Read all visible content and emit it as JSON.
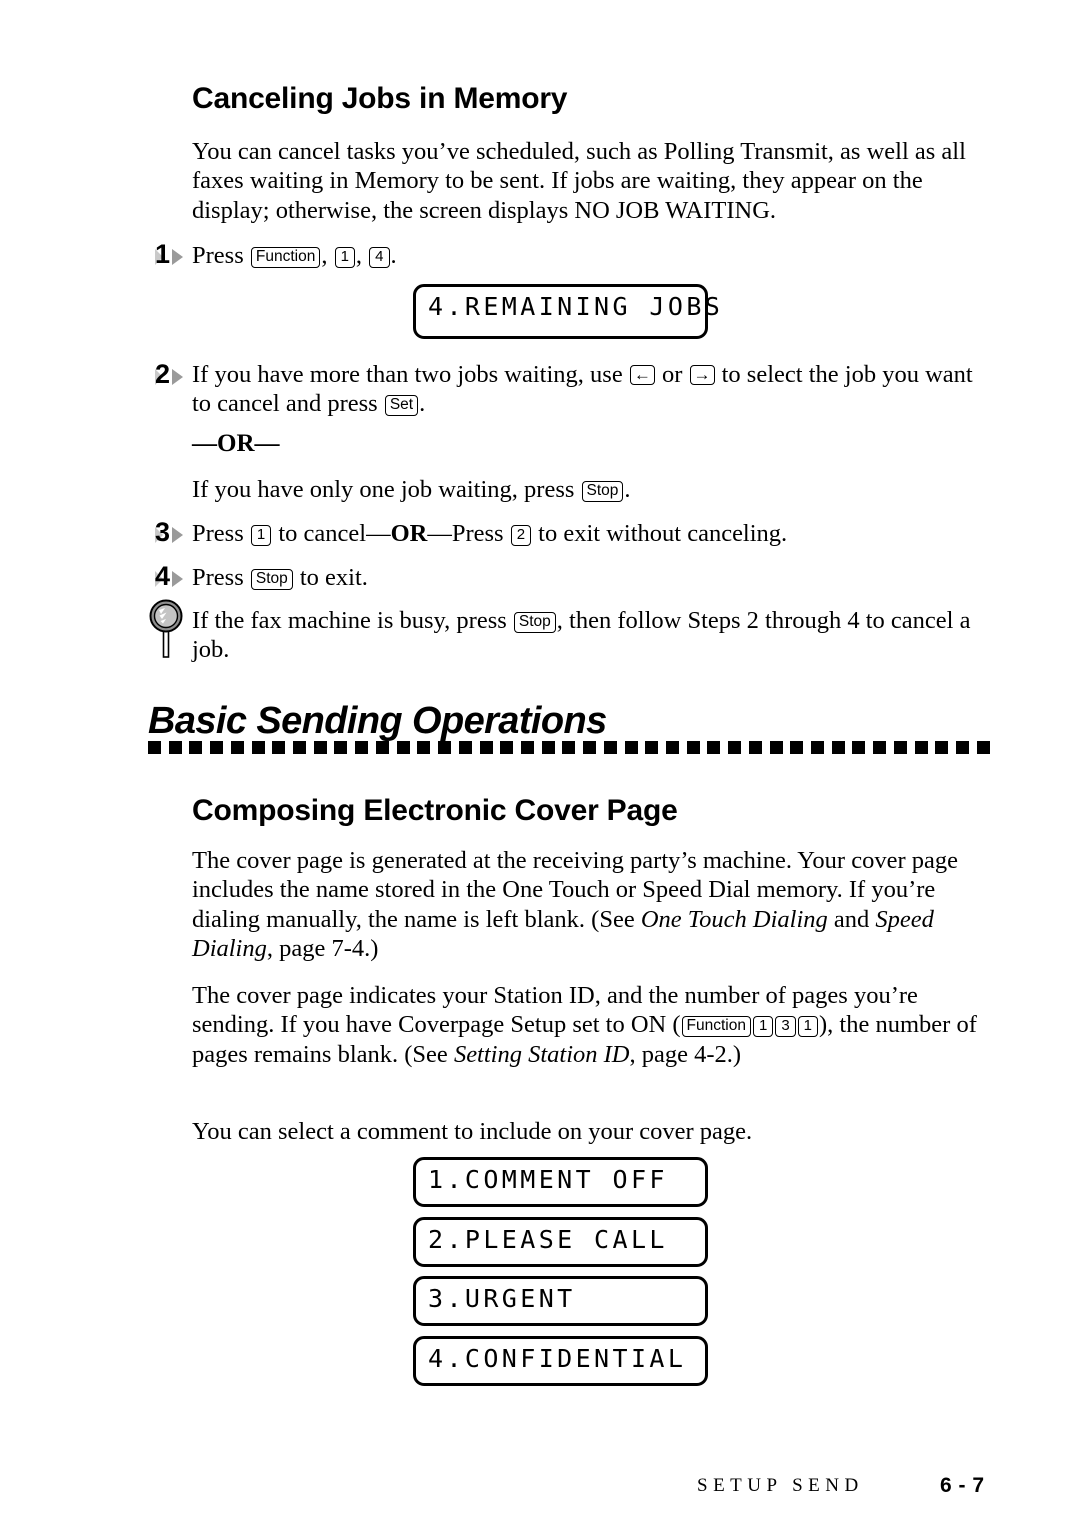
{
  "heading_1": "Canceling Jobs in Memory",
  "intro_paragraph": "You can cancel tasks you’ve scheduled, such as Polling Transmit, as well as all faxes waiting in Memory to be sent. If jobs are waiting, they appear on the display; otherwise, the screen displays NO JOB WAITING.",
  "steps": {
    "one": {
      "number": "1",
      "text_before": "Press ",
      "keys": [
        "Function",
        "1",
        "4"
      ],
      "text_after": "."
    },
    "two": {
      "number": "2",
      "part_a": "If you have more than two jobs waiting, use ",
      "key_left": "←",
      "mid": " or ",
      "key_right": "→",
      "part_b": " to select the job you want to cancel and press ",
      "key_set": "Set",
      "part_c": ".",
      "or_label": "—OR—",
      "alt_text_before": "If you have only one job waiting, press ",
      "alt_key": "Stop",
      "alt_text_after": "."
    },
    "three": {
      "number": "3",
      "part_a": "Press ",
      "key_1": "1",
      "part_b": " to cancel—",
      "or_bold": "OR",
      "part_c": "—Press ",
      "key_2": "2",
      "part_d": " to exit without canceling."
    },
    "four": {
      "number": "4",
      "part_a": "Press ",
      "key_stop": "Stop",
      "part_b": " to exit."
    }
  },
  "note": {
    "icon": "magnifier-icon",
    "part_a": "If the fax machine is busy, press ",
    "key_stop": "Stop",
    "part_b": ", then follow Steps 2 through 4 to cancel a job."
  },
  "section_title": "Basic Sending Operations",
  "heading_2": "Composing Electronic Cover Page",
  "cover_paragraph_1": {
    "part_a": "The cover page is generated at the receiving party’s machine. Your cover page includes the name stored in the One Touch or Speed Dial memory. If you’re dialing manually, the name is left blank. (See ",
    "italic_1": "One Touch Dialing",
    "part_b": " and ",
    "italic_2": "Speed Dialing",
    "part_c": ", page 7-4.)"
  },
  "cover_paragraph_2": {
    "part_a": "The cover page indicates your Station ID, and the number of pages you’re sending. If you have Coverpage Setup set to ON (",
    "keys": [
      "Function",
      "1",
      "3",
      "1"
    ],
    "part_b": "), the number of pages remains blank. (See ",
    "italic_1": "Setting Station ID",
    "part_c": ", page 4-2.)"
  },
  "cover_paragraph_3": "You can select a comment to include on your cover page.",
  "lcd_displays": {
    "remaining_jobs": "4.REMAINING JOBS",
    "comment_options": [
      "1.COMMENT OFF",
      "2.PLEASE CALL",
      "3.URGENT",
      "4.CONFIDENTIAL"
    ]
  },
  "footer": {
    "section_label": "SETUP SEND",
    "page_number": "6 - 7"
  },
  "colors": {
    "text": "#000000",
    "background": "#ffffff",
    "step_marker_triangle": "#9a9a9a",
    "note_icon_lens": "#b4b4b4"
  }
}
